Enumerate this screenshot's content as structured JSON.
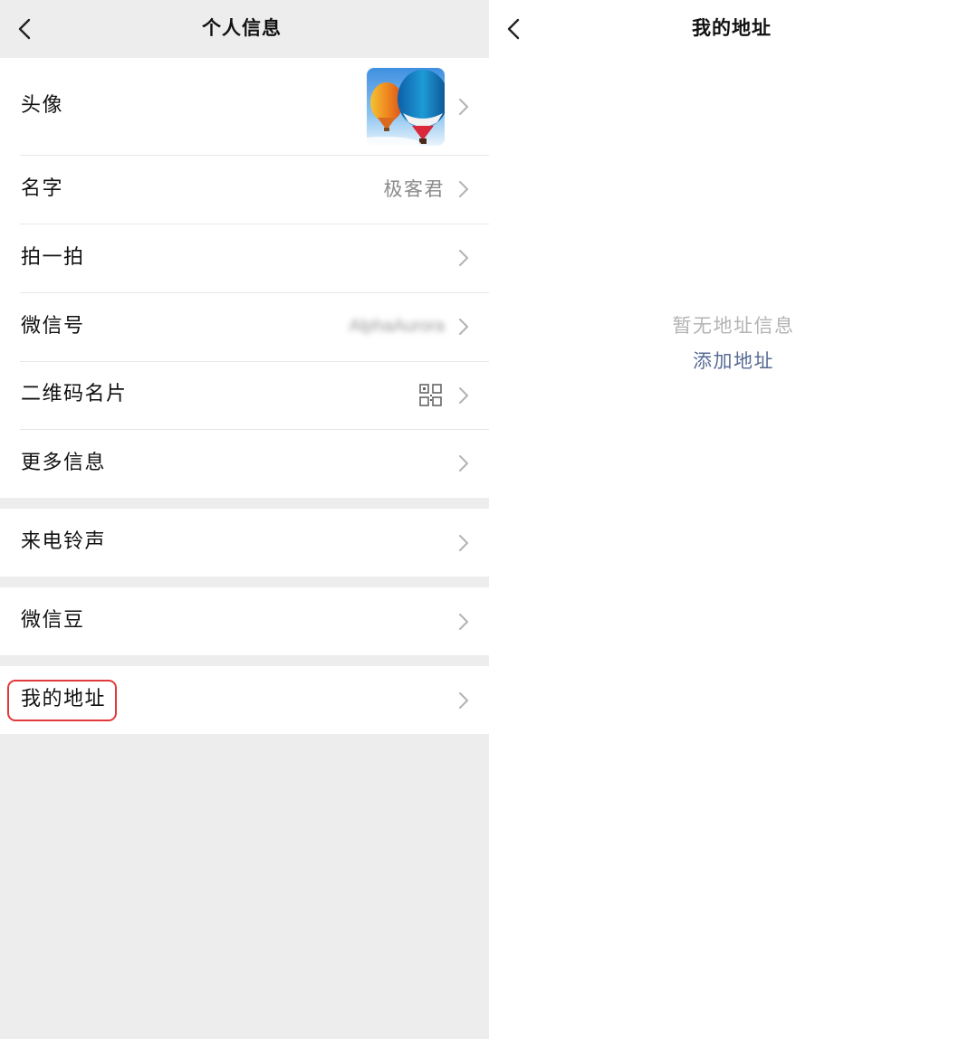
{
  "left_panel": {
    "title": "个人信息",
    "rows": [
      {
        "label": "头像",
        "value": ""
      },
      {
        "label": "名字",
        "value": "极客君"
      },
      {
        "label": "拍一拍",
        "value": ""
      },
      {
        "label": "微信号",
        "value": "AlphaAurora"
      },
      {
        "label": "二维码名片",
        "value": ""
      },
      {
        "label": "更多信息",
        "value": ""
      },
      {
        "label": "来电铃声",
        "value": ""
      },
      {
        "label": "微信豆",
        "value": ""
      },
      {
        "label": "我的地址",
        "value": ""
      }
    ],
    "icons": {
      "back": "chevron-left-icon",
      "row_arrow": "chevron-right-icon",
      "qr": "qr-code-icon",
      "avatar": "hot-air-balloon-image"
    },
    "highlight_color": "#e23a3a"
  },
  "right_panel": {
    "title": "我的地址",
    "empty_text": "暂无地址信息",
    "add_link": "添加地址",
    "link_color": "#576b95"
  }
}
